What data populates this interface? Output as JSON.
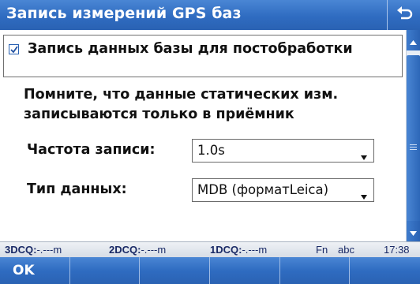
{
  "window": {
    "title": "Запись измерений GPS баз",
    "back_icon": "back-arrow-icon"
  },
  "form": {
    "checkbox": {
      "checked": true,
      "label": "Запись данных базы для постобработки"
    },
    "info_text": "Помните, что данные статических изм. записываются только в приёмник",
    "fields": [
      {
        "label": "Частота записи:",
        "value": "1.0s"
      },
      {
        "label": "Тип данных:",
        "value": "MDB (форматLeica)"
      }
    ]
  },
  "statusbar": {
    "dcq3_label": "3DCQ:",
    "dcq3_value": "-.---m",
    "dcq2_label": "2DCQ:",
    "dcq2_value": "-.---m",
    "dcq1_label": "1DCQ:",
    "dcq1_value": "-.---m",
    "fn": "Fn",
    "input_mode": "abc",
    "time": "17:38"
  },
  "softkeys": [
    "OK",
    "",
    "",
    "",
    "",
    ""
  ],
  "colors": {
    "title_bar": "#2f6cc1",
    "scrollbar": "#2a62b3",
    "status_text": "#1a2a66"
  }
}
